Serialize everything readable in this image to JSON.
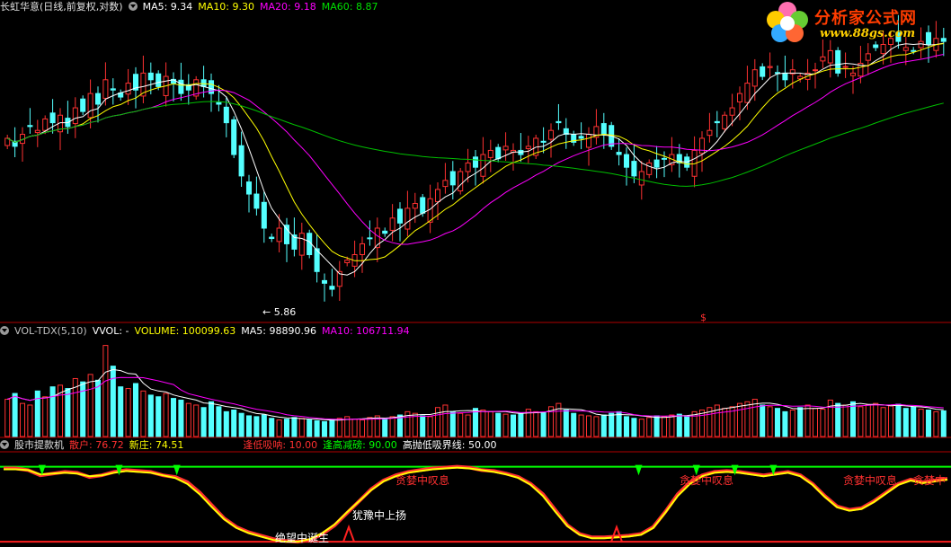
{
  "header1": {
    "title": "长虹华意(日线,前复权,对数)",
    "ma5": "MA5: 9.34",
    "ma10": "MA10: 9.30",
    "ma20": "MA20: 9.18",
    "ma60": "MA60: 8.87"
  },
  "header2": {
    "title": "VOL-TDX(5,10)",
    "vvol": "VVOL: -",
    "volume": "VOLUME: 100099.63",
    "ma5": "MA5: 98890.96",
    "ma10": "MA10: 106711.94"
  },
  "header3": {
    "title": "股市提款机",
    "sanhu": "散户: 76.72",
    "xinzhuang": "新庄: 74.51",
    "fengdi": "逢低吸呐: 10.00",
    "fenggao": "逢高减磅: 90.00",
    "gaopao": "高抛低吸界线: 50.00"
  },
  "logo": {
    "cn": "分析家公式网",
    "url": "www.88gs.com"
  },
  "annotations": {
    "low_price": "5.86",
    "marker": "$",
    "a1": "贪婪中叹息",
    "a2": "绝望中诞生",
    "a3": "犹豫中上扬",
    "a4": "贪婪中叹息",
    "a5": "贪婪中叹息",
    "a6": "贪婪中"
  },
  "colors": {
    "up": "#ff3232",
    "down": "#54ffff",
    "ma5": "#ffffff",
    "ma10": "#ffff00",
    "ma20": "#ff00ff",
    "ma60": "#00c000",
    "grid": "#b00000"
  },
  "chart_data": {
    "type": "candlestick",
    "price_scale": "log",
    "close": [
      9.0,
      8.8,
      9.1,
      9.3,
      9.2,
      9.5,
      9.4,
      9.6,
      9.3,
      9.8,
      9.7,
      10.2,
      9.9,
      10.6,
      10.3,
      10.1,
      10.5,
      10.3,
      10.8,
      10.6,
      10.4,
      10.7,
      10.5,
      10.2,
      10.3,
      10.6,
      10.4,
      10.2,
      9.9,
      9.4,
      8.6,
      8.1,
      7.7,
      7.4,
      7.0,
      6.8,
      7.0,
      6.7,
      6.6,
      6.9,
      6.5,
      6.2,
      6.0,
      5.9,
      6.2,
      6.4,
      6.5,
      6.7,
      6.8,
      7.0,
      6.9,
      7.2,
      7.1,
      7.4,
      7.5,
      7.3,
      7.6,
      7.8,
      8.0,
      7.9,
      8.2,
      8.4,
      8.3,
      8.6,
      8.7,
      8.5,
      8.8,
      8.7,
      8.6,
      8.8,
      9.0,
      8.9,
      9.2,
      9.4,
      9.1,
      8.9,
      9.0,
      9.1,
      9.3,
      9.1,
      8.8,
      8.6,
      8.3,
      8.1,
      8.2,
      8.4,
      8.3,
      8.5,
      8.6,
      8.4,
      8.3,
      8.7,
      9.0,
      9.2,
      9.4,
      9.6,
      9.8,
      10.2,
      10.5,
      10.9,
      10.7,
      11.0,
      10.8,
      10.6,
      10.9,
      10.7,
      10.8,
      10.9,
      11.3,
      11.5,
      10.8,
      11.0,
      10.8,
      11.1,
      11.4,
      11.6,
      11.7,
      11.9,
      11.8,
      11.6,
      11.5,
      11.8,
      11.7,
      11.9,
      11.8
    ],
    "volume": [
      45,
      52,
      40,
      38,
      55,
      48,
      60,
      62,
      58,
      70,
      66,
      75,
      68,
      110,
      85,
      60,
      58,
      64,
      55,
      50,
      48,
      52,
      46,
      44,
      40,
      38,
      35,
      42,
      36,
      30,
      32,
      28,
      25,
      24,
      26,
      22,
      20,
      21,
      23,
      22,
      20,
      19,
      18,
      20,
      22,
      24,
      21,
      20,
      23,
      25,
      22,
      24,
      26,
      30,
      28,
      25,
      24,
      35,
      38,
      30,
      28,
      26,
      34,
      32,
      30,
      28,
      27,
      26,
      28,
      33,
      30,
      29,
      36,
      40,
      32,
      28,
      26,
      25,
      24,
      26,
      28,
      30,
      24,
      22,
      21,
      23,
      25,
      24,
      26,
      27,
      25,
      30,
      32,
      35,
      38,
      34,
      36,
      40,
      42,
      45,
      38,
      36,
      34,
      30,
      32,
      35,
      38,
      34,
      33,
      44,
      40,
      38,
      42,
      36,
      38,
      40,
      35,
      37,
      39,
      34,
      36,
      33,
      32,
      30,
      31
    ],
    "sanhu": [
      88,
      88,
      86,
      80,
      82,
      84,
      83,
      78,
      80,
      84,
      86,
      85,
      84,
      80,
      78,
      72,
      60,
      45,
      30,
      20,
      14,
      10,
      6,
      4,
      3,
      5,
      12,
      22,
      36,
      50,
      64,
      74,
      80,
      84,
      86,
      88,
      89,
      90,
      89,
      86,
      85,
      82,
      78,
      70,
      58,
      40,
      22,
      12,
      8,
      8,
      9,
      10,
      12,
      20,
      38,
      58,
      72,
      80,
      84,
      85,
      84,
      82,
      80,
      82,
      84,
      80,
      70,
      56,
      44,
      40,
      42,
      50,
      60,
      70,
      75,
      72,
      74,
      76
    ],
    "xinzhuang": [
      87,
      87,
      86,
      81,
      82,
      83,
      82,
      79,
      80,
      83,
      85,
      84,
      83,
      80,
      77,
      70,
      58,
      43,
      29,
      19,
      13,
      9,
      5,
      3,
      3,
      6,
      13,
      23,
      37,
      50,
      63,
      73,
      79,
      83,
      85,
      87,
      88,
      89,
      88,
      86,
      84,
      81,
      77,
      69,
      56,
      38,
      21,
      11,
      7,
      7,
      8,
      9,
      11,
      19,
      37,
      56,
      70,
      79,
      83,
      84,
      83,
      81,
      79,
      81,
      83,
      79,
      69,
      55,
      43,
      39,
      41,
      49,
      59,
      69,
      74,
      71,
      73,
      75
    ]
  }
}
